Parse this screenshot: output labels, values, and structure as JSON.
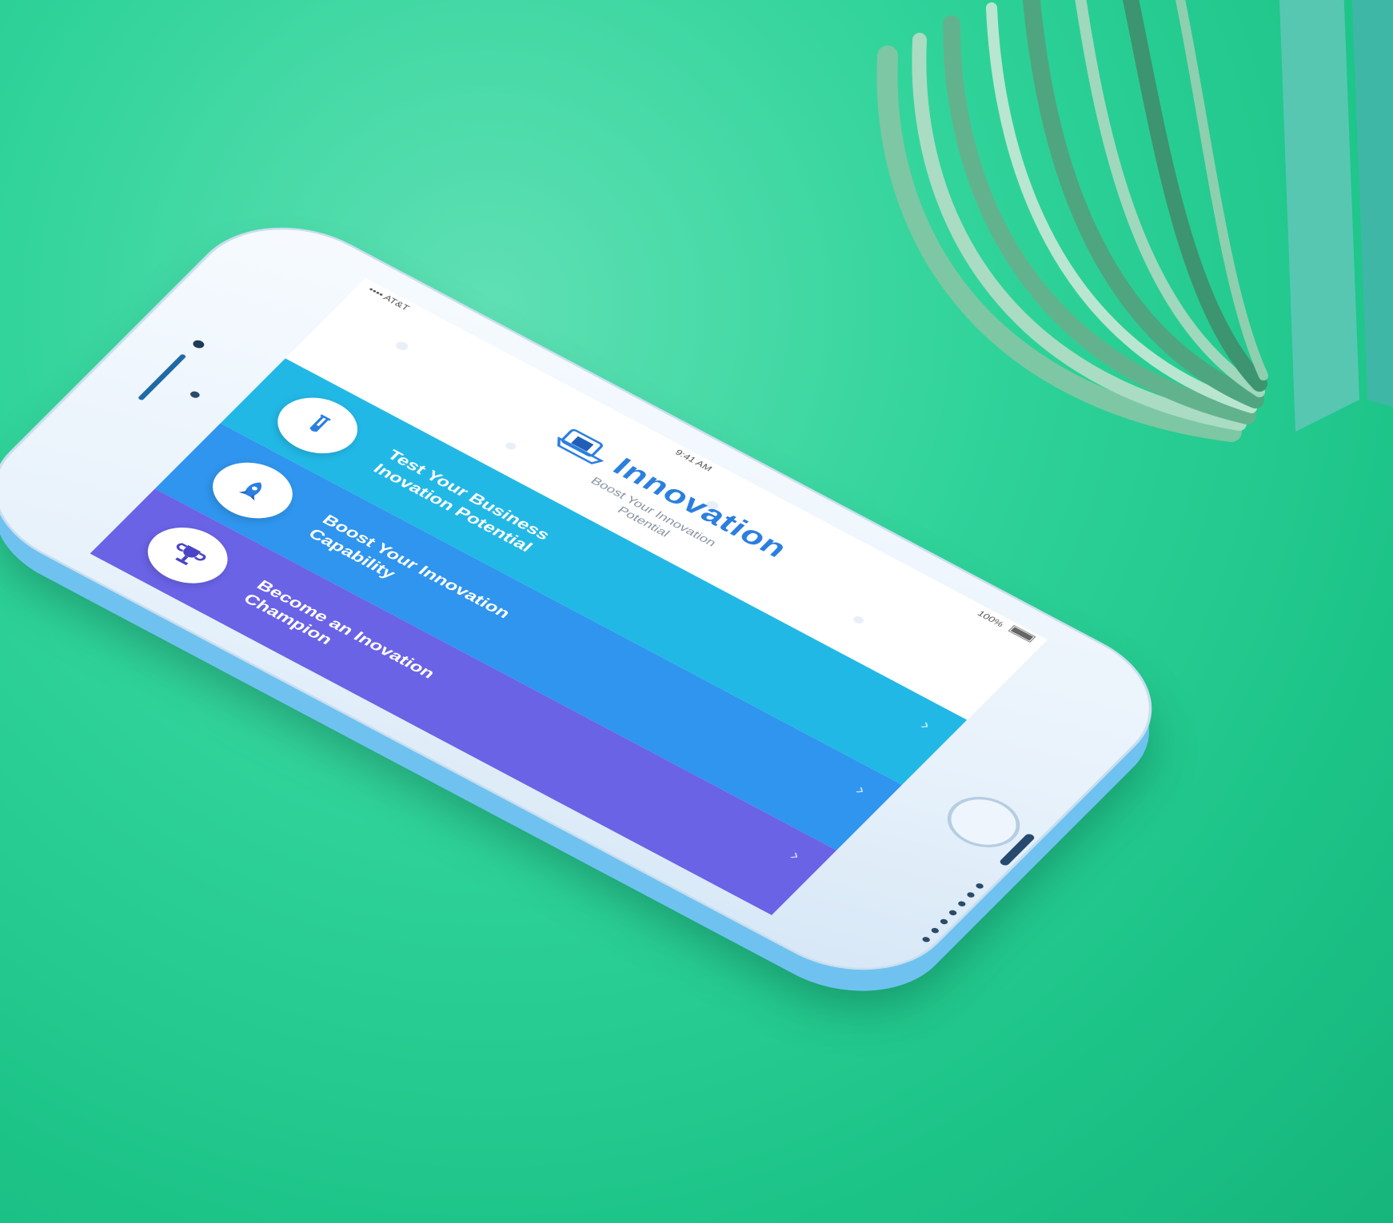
{
  "status_bar": {
    "carrier": "•••• AT&T",
    "time": "9:41 AM",
    "battery": "100%"
  },
  "header": {
    "title": "Innovation",
    "subtitle": "Boost Your Innovation Potential"
  },
  "menu": {
    "items": [
      {
        "label": "Test Your Business Inovation Potential",
        "icon": "test-tube-icon",
        "color": "#22b8e6"
      },
      {
        "label": "Boost Your Innovation Capability",
        "icon": "rocket-icon",
        "color": "#2f95ee"
      },
      {
        "label": "Become an Inovation Champion",
        "icon": "trophy-icon",
        "color": "#6a63e6"
      }
    ]
  },
  "colors": {
    "background": "#1cc387",
    "accent": "#2a7fe0"
  }
}
